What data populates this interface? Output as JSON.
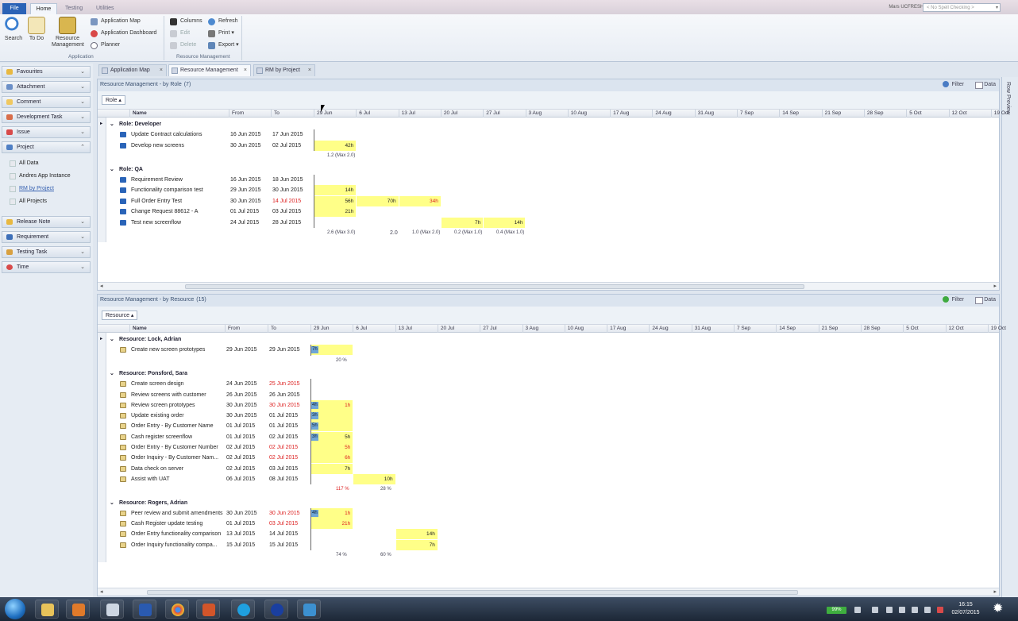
{
  "ribbon_tabs": [
    "File",
    "Home",
    "Testing",
    "Utilities"
  ],
  "user": "Mars UCFRESH77",
  "spell_check": "< No Spell Checking >",
  "ribbon": {
    "search": "Search",
    "todo": "To Do",
    "resource_mgmt": "Resource Management",
    "app_map": "Application Map",
    "app_dashboard": "Application Dashboard",
    "planner": "Planner",
    "group_application": "Application",
    "columns": "Columns",
    "refresh": "Refresh",
    "edit": "Edit",
    "print": "Print",
    "delete": "Delete",
    "export": "Export",
    "group_rm": "Resource Management"
  },
  "sidebar": {
    "favourites": "Favourites",
    "attachment": "Attachment",
    "comment": "Comment",
    "dev_task": "Development Task",
    "issue": "Issue",
    "project": "Project",
    "project_items": [
      "All Data",
      "Andres App Instance",
      "RM by Project",
      "All Projects"
    ],
    "release_note": "Release Note",
    "requirement": "Requirement",
    "testing_task": "Testing Task",
    "time": "Time"
  },
  "doc_tabs": [
    "Application Map",
    "Resource Management",
    "RM by Project"
  ],
  "filter_label": "Filter",
  "data_label": "Data",
  "row_preview": "Row Preview",
  "date_headers": [
    "29 Jun",
    "6 Jul",
    "13 Jul",
    "20 Jul",
    "27 Jul",
    "3 Aug",
    "10 Aug",
    "17 Aug",
    "24 Aug",
    "31 Aug",
    "7 Sep",
    "14 Sep",
    "21 Sep",
    "28 Sep",
    "5 Oct",
    "12 Oct",
    "19 Oct"
  ],
  "col_name": "Name",
  "col_from": "From",
  "col_to": "To",
  "role_panel": {
    "title": "Resource Management - by Role",
    "count": "(7)",
    "group_btn": "Role",
    "groups": [
      {
        "label": "Role: Developer",
        "rows": [
          {
            "name": "Update Contract calculations",
            "from": "16 Jun 2015",
            "to": "17 Jun 2015"
          },
          {
            "name": "Develop new screens",
            "from": "30 Jun 2015",
            "to": "02 Jul 2015",
            "w0": "42h"
          }
        ],
        "sums": [
          "1.2 (Max 2.0)"
        ]
      },
      {
        "label": "Role: QA",
        "rows": [
          {
            "name": "Requirement Review",
            "from": "16 Jun 2015",
            "to": "18 Jun 2015"
          },
          {
            "name": "Functionality comparison test",
            "from": "29 Jun 2015",
            "to": "30 Jun 2015",
            "w0": "14h"
          },
          {
            "name": "Full Order Entry Test",
            "from": "30 Jun 2015",
            "to": "14 Jul 2015",
            "w0": "56h",
            "w1": "70h",
            "w2": "34h"
          },
          {
            "name": "Change Request 88612 - A",
            "from": "01 Jul 2015",
            "to": "03 Jul 2015",
            "w0": "21h"
          },
          {
            "name": "Test new screenflow",
            "from": "24 Jul 2015",
            "to": "28 Jul 2015",
            "w3": "7h",
            "w4": "14h"
          }
        ],
        "sums": [
          "2.6 (Max 3.0)",
          "2.0",
          "1.0 (Max 2.0)",
          "0.2 (Max 1.0)",
          "0.4 (Max 1.0)"
        ]
      }
    ]
  },
  "res_panel": {
    "title": "Resource Management - by Resource",
    "count": "(15)",
    "group_btn": "Resource",
    "groups": [
      {
        "label": "Resource: Lock, Adrian",
        "rows": [
          {
            "name": "Create new screen prototypes",
            "from": "29 Jun 2015",
            "to": "29 Jun 2015",
            "blue": "7h"
          }
        ],
        "sums": [
          "20 %"
        ]
      },
      {
        "label": "Resource: Ponsford, Sara",
        "rows": [
          {
            "name": "Create screen design",
            "from": "24 Jun 2015",
            "to": "25 Jun 2015"
          },
          {
            "name": "Review screens with customer",
            "from": "26 Jun 2015",
            "to": "26 Jun 2015"
          },
          {
            "name": "Review screen prototypes",
            "from": "30 Jun 2015",
            "to": "30 Jun 2015",
            "blue": "4h",
            "w0": "1h"
          },
          {
            "name": "Update existing order",
            "from": "30 Jun 2015",
            "to": "01 Jul 2015",
            "blue": "3h"
          },
          {
            "name": "Order Entry - By Customer Name",
            "from": "01 Jul 2015",
            "to": "01 Jul 2015",
            "blue": "5h"
          },
          {
            "name": "Cash register screenflow",
            "from": "01 Jul 2015",
            "to": "02 Jul 2015",
            "blue": "3h",
            "w0": "5h"
          },
          {
            "name": "Order Entry - By Customer Number",
            "from": "02 Jul 2015",
            "to": "02 Jul 2015",
            "w0": "5h"
          },
          {
            "name": "Order Inquiry - By Customer Nam...",
            "from": "02 Jul 2015",
            "to": "02 Jul 2015",
            "w0": "6h"
          },
          {
            "name": "Data check on server",
            "from": "02 Jul 2015",
            "to": "03 Jul 2015",
            "w0": "7h"
          },
          {
            "name": "Assist with UAT",
            "from": "06 Jul 2015",
            "to": "08 Jul 2015",
            "w1": "10h"
          }
        ],
        "sums": [
          "117 %",
          "28 %"
        ]
      },
      {
        "label": "Resource: Rogers, Adrian",
        "rows": [
          {
            "name": "Peer review and submit amendments",
            "from": "30 Jun 2015",
            "to": "30 Jun 2015",
            "blue": "4h",
            "w0": "1h"
          },
          {
            "name": "Cash Register update testing",
            "from": "01 Jul 2015",
            "to": "03 Jul 2015",
            "w0": "21h"
          },
          {
            "name": "Order Entry functionality comparison",
            "from": "13 Jul 2015",
            "to": "14 Jul 2015",
            "w2": "14h"
          },
          {
            "name": "Order Inquiry functionality compa...",
            "from": "15 Jul 2015",
            "to": "15 Jul 2015",
            "w2": "7h"
          }
        ],
        "sums": [
          "74 %",
          "60 %"
        ]
      }
    ]
  },
  "tray": {
    "battery": "99%",
    "time": "16:15",
    "date": "02/07/2015"
  }
}
